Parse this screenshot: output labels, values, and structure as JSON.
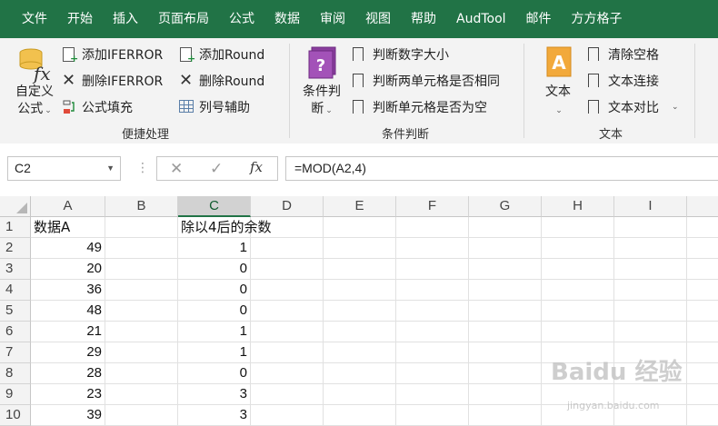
{
  "menu": {
    "tabs": [
      "文件",
      "开始",
      "插入",
      "页面布局",
      "公式",
      "数据",
      "审阅",
      "视图",
      "帮助",
      "AudTool",
      "邮件",
      "方方格子"
    ]
  },
  "ribbon": {
    "custom_formula": {
      "line1": "自定义",
      "line2": "公式"
    },
    "add_iferror": "添加IFERROR",
    "delete_iferror": "删除IFERROR",
    "formula_fill": "公式填充",
    "add_round": "添加Round",
    "delete_round": "删除Round",
    "col_row_helper": "列号辅助",
    "group_convenient": "便捷处理",
    "condition_judge": {
      "line1": "条件判",
      "line2": "断"
    },
    "judge_number_size": "判断数字大小",
    "judge_two_cells_same": "判断两单元格是否相同",
    "judge_cell_empty": "判断单元格是否为空",
    "group_condition": "条件判断",
    "text_btn": "文本",
    "clear_spaces": "清除空格",
    "text_concat": "文本连接",
    "text_compare": "文本对比",
    "group_text": "文本"
  },
  "formula_bar": {
    "name_box": "C2",
    "formula": "=MOD(A2,4)"
  },
  "sheet": {
    "columns": [
      "A",
      "B",
      "C",
      "D",
      "E",
      "F",
      "G",
      "H",
      "I"
    ],
    "selected_column": "C",
    "rows": [
      {
        "num": "1",
        "A": "数据A",
        "C": "除以4后的余数"
      },
      {
        "num": "2",
        "A": "49",
        "C": "1"
      },
      {
        "num": "3",
        "A": "20",
        "C": "0"
      },
      {
        "num": "4",
        "A": "36",
        "C": "0"
      },
      {
        "num": "5",
        "A": "48",
        "C": "0"
      },
      {
        "num": "6",
        "A": "21",
        "C": "1"
      },
      {
        "num": "7",
        "A": "29",
        "C": "1"
      },
      {
        "num": "8",
        "A": "28",
        "C": "0"
      },
      {
        "num": "9",
        "A": "23",
        "C": "3"
      },
      {
        "num": "10",
        "A": "39",
        "C": "3"
      }
    ]
  },
  "watermark": {
    "main": "Baidu 经验",
    "sub": "jingyan.baidu.com"
  },
  "colors": {
    "excel_green": "#217346",
    "ribbon_bg": "#f3f3f3",
    "header_bg": "#f3f3f3"
  }
}
